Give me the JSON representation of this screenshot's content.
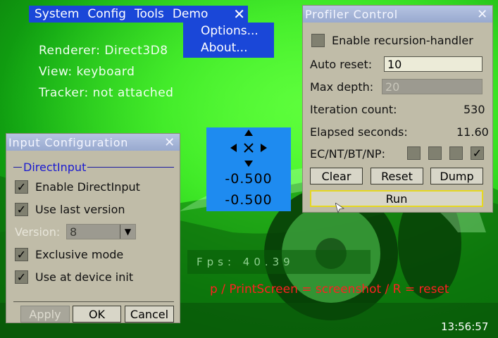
{
  "colors": {
    "background": "#2ee01a",
    "menu": "#1a47d8",
    "window": "#c0bca8",
    "pad": "#1e8bf0"
  },
  "menubar": {
    "items": [
      "System",
      "Config",
      "Tools",
      "Demo"
    ],
    "close_icon": "close-icon"
  },
  "demo_menu": {
    "items": [
      "Options...",
      "About..."
    ]
  },
  "info": {
    "renderer": "Renderer: Direct3D8",
    "view": "View: keyboard",
    "tracker": "Tracker: not attached"
  },
  "profiler": {
    "title": "Profiler Control",
    "enable_recursion_label": "Enable recursion-handler",
    "enable_recursion_checked": false,
    "auto_reset_label": "Auto reset:",
    "auto_reset_value": "10",
    "max_depth_label": "Max depth:",
    "max_depth_value": "20",
    "iteration_label": "Iteration count:",
    "iteration_value": "530",
    "elapsed_label": "Elapsed seconds:",
    "elapsed_value": "11.60",
    "ec_label": "EC/NT/BT/NP:",
    "ec_checks": [
      false,
      false,
      false,
      true
    ],
    "clear_label": "Clear",
    "reset_label": "Reset",
    "dump_label": "Dump",
    "run_label": "Run"
  },
  "input_config": {
    "title": "Input Configuration",
    "group_label": "DirectInput",
    "enable_label": "Enable DirectInput",
    "enable_checked": true,
    "last_version_label": "Use last version",
    "last_version_checked": true,
    "version_label": "Version:",
    "version_value": "8",
    "exclusive_label": "Exclusive mode",
    "exclusive_checked": true,
    "device_init_label": "Use at device init",
    "device_init_checked": true,
    "apply_label": "Apply",
    "ok_label": "OK",
    "cancel_label": "Cancel"
  },
  "pad": {
    "value_x": "-0.500",
    "value_y": "-0.500"
  },
  "fps_text": "Fps: 40.39",
  "marquee_text": "p / PrintScreen = screenshot / R = reset",
  "clock": "13:56:57"
}
